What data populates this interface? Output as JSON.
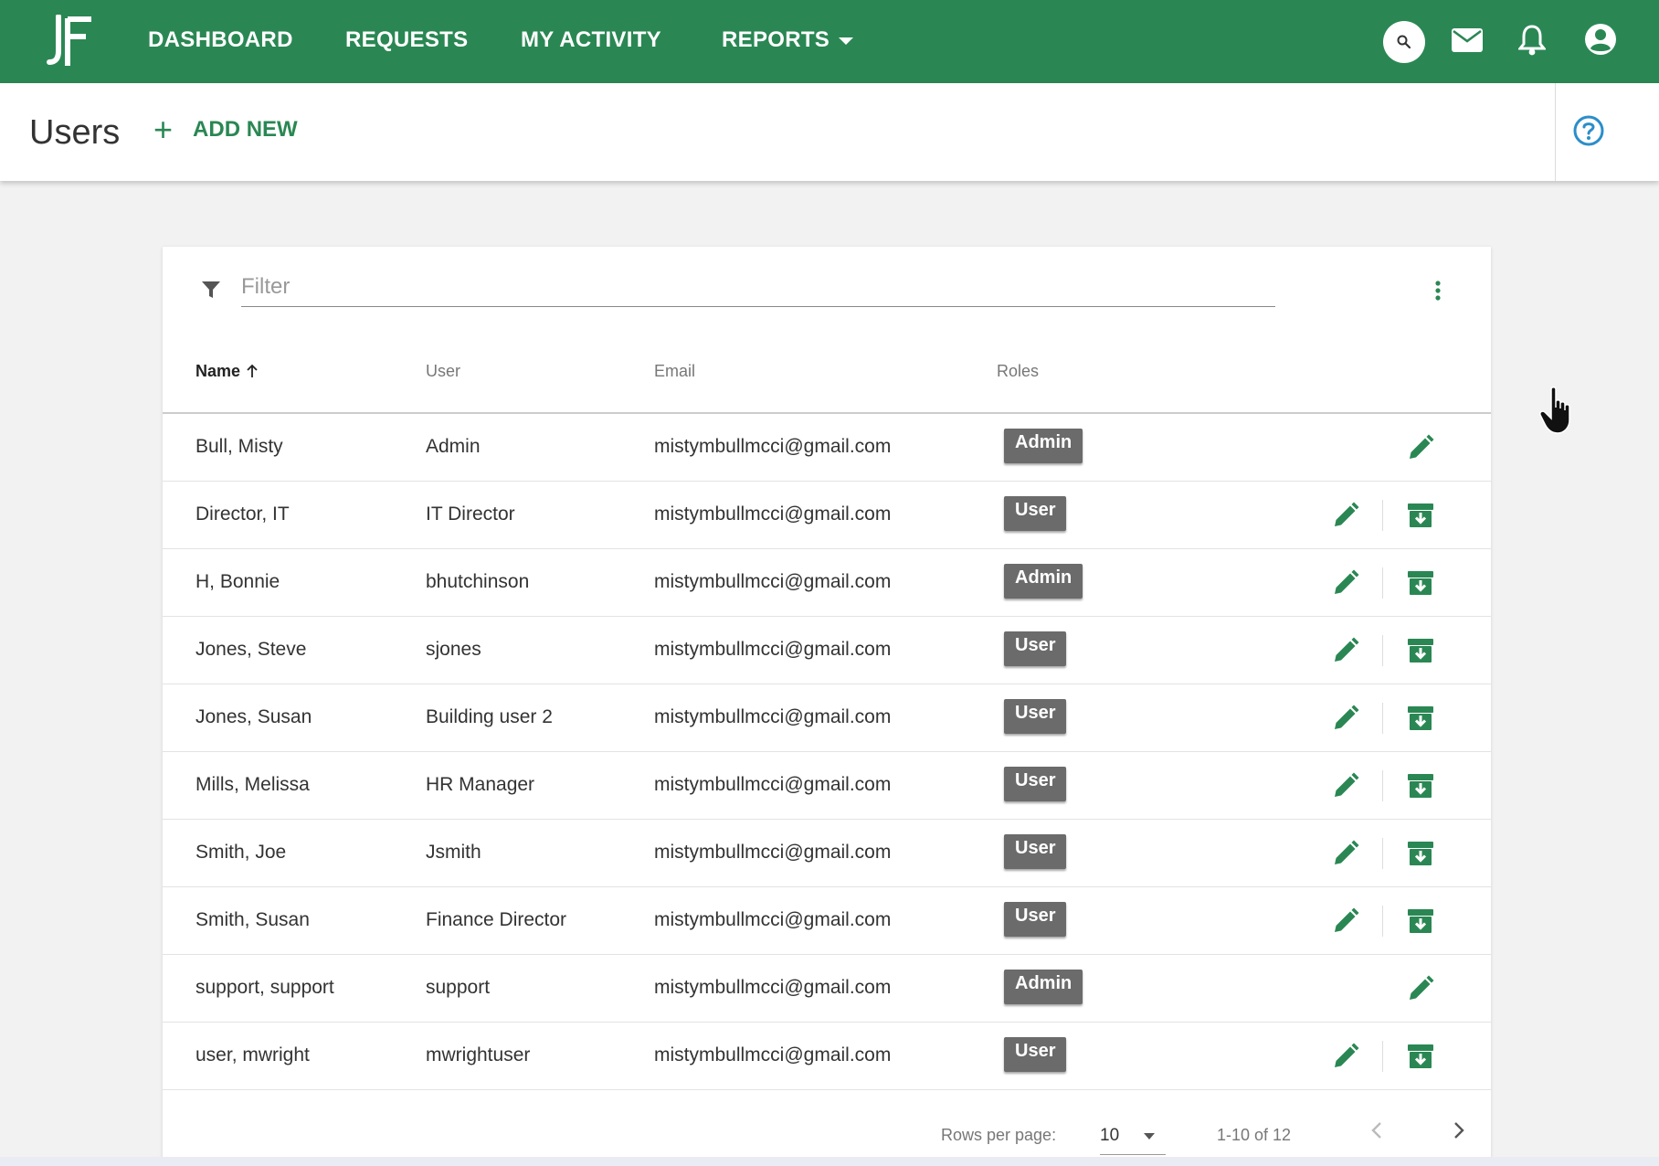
{
  "nav": {
    "logo_text": "JF",
    "items": [
      {
        "label": "DASHBOARD"
      },
      {
        "label": "REQUESTS"
      },
      {
        "label": "MY ACTIVITY"
      },
      {
        "label": "REPORTS"
      }
    ],
    "icons": [
      "search-icon",
      "mail-icon",
      "bell-icon",
      "account-icon"
    ],
    "color": "#2a8753"
  },
  "header": {
    "title": "Users",
    "add_new_plus": "+",
    "add_new_label": "ADD NEW",
    "help_icon": "help-circle-icon"
  },
  "filter": {
    "placeholder": "Filter",
    "value": ""
  },
  "table": {
    "columns": [
      {
        "label": "Name",
        "sorted": "asc"
      },
      {
        "label": "User"
      },
      {
        "label": "Email"
      },
      {
        "label": "Roles"
      }
    ],
    "rows": [
      {
        "name": "Bull, Misty",
        "user": "Admin",
        "email": "mistymbullmcci@gmail.com",
        "role": "Admin",
        "archive": false
      },
      {
        "name": "Director, IT",
        "user": "IT Director",
        "email": "mistymbullmcci@gmail.com",
        "role": "User",
        "archive": true
      },
      {
        "name": "H, Bonnie",
        "user": "bhutchinson",
        "email": "mistymbullmcci@gmail.com",
        "role": "Admin",
        "archive": true
      },
      {
        "name": "Jones, Steve",
        "user": "sjones",
        "email": "mistymbullmcci@gmail.com",
        "role": "User",
        "archive": true
      },
      {
        "name": "Jones, Susan",
        "user": "Building user 2",
        "email": "mistymbullmcci@gmail.com",
        "role": "User",
        "archive": true
      },
      {
        "name": "Mills, Melissa",
        "user": "HR Manager",
        "email": "mistymbullmcci@gmail.com",
        "role": "User",
        "archive": true
      },
      {
        "name": "Smith, Joe",
        "user": "Jsmith",
        "email": "mistymbullmcci@gmail.com",
        "role": "User",
        "archive": true
      },
      {
        "name": "Smith, Susan",
        "user": "Finance Director",
        "email": "mistymbullmcci@gmail.com",
        "role": "User",
        "archive": true
      },
      {
        "name": "support, support",
        "user": "support",
        "email": "mistymbullmcci@gmail.com",
        "role": "Admin",
        "archive": false
      },
      {
        "name": "user, mwright",
        "user": "mwrightuser",
        "email": "mistymbullmcci@gmail.com",
        "role": "User",
        "archive": true
      }
    ]
  },
  "footer": {
    "rows_per_page_label": "Rows per page:",
    "rows_per_page_value": "10",
    "range_text": "1-10 of 12"
  },
  "colors": {
    "accent": "#2a8753",
    "badge": "#6b6b6b"
  }
}
